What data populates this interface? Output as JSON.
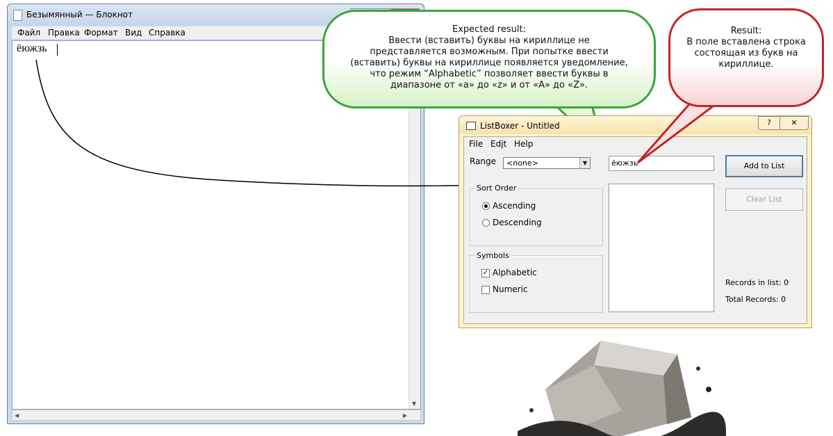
{
  "notepad": {
    "title": "Безымянный — Блокнот",
    "menu": [
      "Файл",
      "Правка",
      "Формат",
      "Вид",
      "Справка"
    ],
    "content": "ёюжзь",
    "controls": [
      "–",
      "□",
      "✕"
    ]
  },
  "callout_expected": {
    "heading": "Expected result:",
    "body": "Ввести (вставить) буквы на кириллице не представляется возможным. При попытке ввести (вставить) буквы на кириллице  появляется уведомление, что режим “Alphabetic” позволяет ввести буквы в диапазоне от «a» до «z» и от «A» до «Z».",
    "border_color": "#3aa53a"
  },
  "callout_result": {
    "heading": "Result:",
    "body": "В поле вставлена строка состоящая из букв на кириллице.",
    "border_color": "#c32525"
  },
  "listboxer": {
    "title": "ListBoxer - Untitled",
    "help_btn": "?",
    "close_btn": "✕",
    "menu": [
      "File",
      "Edjt",
      "Help"
    ],
    "range_label": "Range",
    "range_value": "<none>",
    "sort_order": {
      "legend": "Sort Order",
      "options": [
        {
          "label": "Ascending",
          "selected": true
        },
        {
          "label": "Descending",
          "selected": false
        }
      ]
    },
    "symbols": {
      "legend": "Symbols",
      "options": [
        {
          "label": "Alphabetic",
          "checked": true
        },
        {
          "label": "Numeric",
          "checked": false
        }
      ]
    },
    "input_value": "ёюжзь",
    "add_button": "Add to List",
    "clear_button": "Clear List",
    "records_in_list": "Records in list: 0",
    "total_records": "Total Records: 0"
  }
}
